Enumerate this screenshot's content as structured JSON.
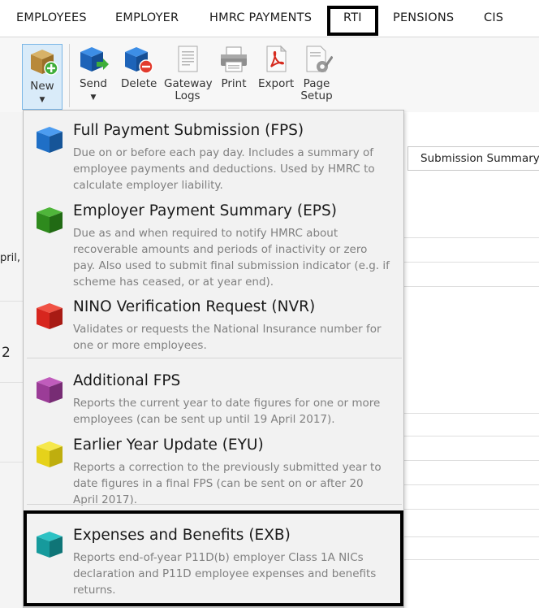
{
  "menu": {
    "tabs": [
      {
        "label": "EMPLOYEES"
      },
      {
        "label": "EMPLOYER"
      },
      {
        "label": "HMRC PAYMENTS"
      },
      {
        "label": "RTI"
      },
      {
        "label": "PENSIONS"
      },
      {
        "label": "CIS"
      }
    ],
    "selected": "RTI"
  },
  "toolbar": {
    "new": {
      "label": "New",
      "icon": "new-submission-icon"
    },
    "send": {
      "label": "Send",
      "icon": "send-icon"
    },
    "delete": {
      "label": "Delete",
      "icon": "delete-icon"
    },
    "gateway_logs": {
      "label_line1": "Gateway",
      "label_line2": "Logs",
      "icon": "gateway-logs-icon"
    },
    "print": {
      "label": "Print",
      "icon": "print-icon"
    },
    "export": {
      "label": "Export",
      "icon": "pdf-export-icon"
    },
    "page_setup": {
      "label_line1": "Page",
      "label_line2": "Setup",
      "icon": "page-setup-icon"
    }
  },
  "background": {
    "left_text": "pril,",
    "left_number": "2",
    "summary_tab": "Submission Summary"
  },
  "dropdown": {
    "items": [
      {
        "title": "Full Payment Submission (FPS)",
        "description": "Due on or before each pay day. Includes a summary of employee payments and deductions. Used by HMRC to calculate employer liability.",
        "color": "#1f6fc6"
      },
      {
        "title": "Employer Payment Summary (EPS)",
        "description": "Due as and when required to notify HMRC about recoverable amounts and periods of inactivity or zero pay. Also used to submit final submission indicator (e.g. if scheme has ceased, or at year end).",
        "color": "#2e8a1d"
      },
      {
        "title": "NINO Verification Request (NVR)",
        "description": "Validates or requests the National Insurance number for one or more employees.",
        "color": "#d7261e"
      },
      {
        "title": "Additional FPS",
        "description": "Reports the current year to date figures for one or more employees (can be sent up until 19 April 2017).",
        "color": "#9b3c97"
      },
      {
        "title": "Earlier Year Update (EYU)",
        "description": "Reports a correction to the previously submitted year to date figures in a final FPS (can be sent on or after 20 April 2017).",
        "color": "#e6d21a"
      },
      {
        "title": "Expenses and Benefits (EXB)",
        "description": "Reports end-of-year P11D(b) employer Class 1A NICs declaration and P11D employee expenses and benefits returns.",
        "color": "#169a9c"
      }
    ]
  },
  "colors": {
    "accent": "#7ab6e6",
    "highlight_border": "#000000"
  }
}
